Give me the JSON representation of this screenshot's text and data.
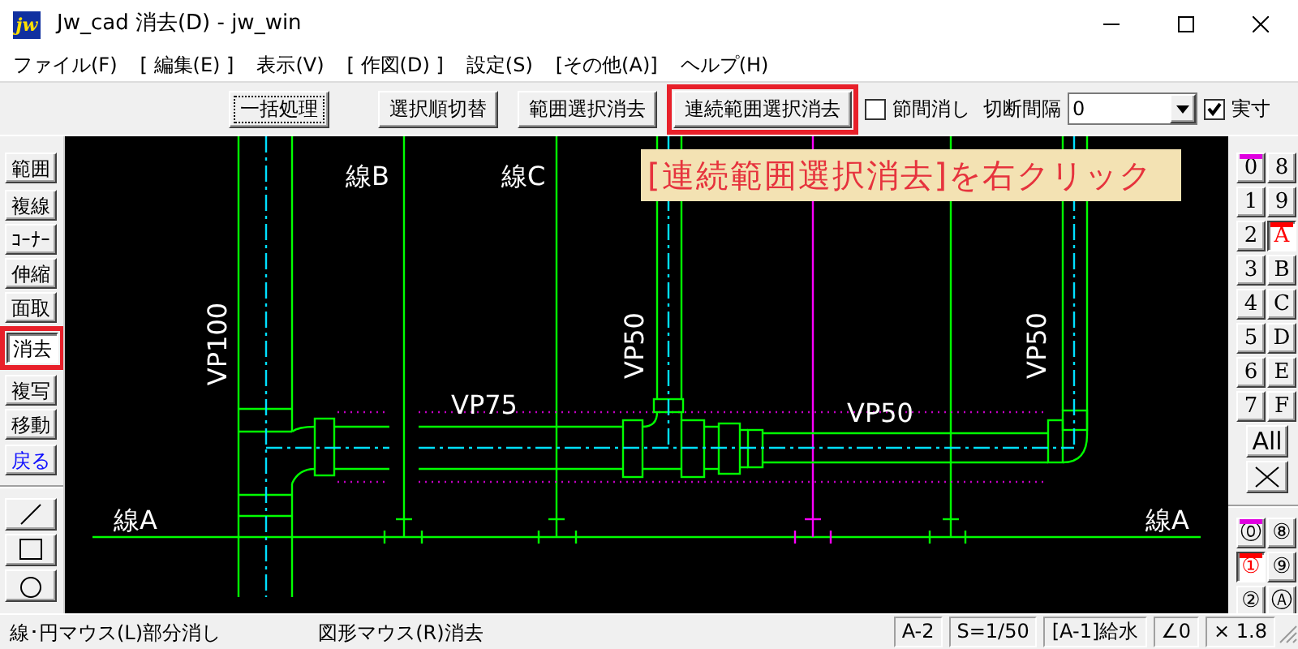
{
  "window": {
    "icon_text": "jw",
    "title": "Jw_cad 消去(D) - jw_win"
  },
  "menu": [
    "ファイル(F)",
    "[ 編集(E) ]",
    "表示(V)",
    "[ 作図(D) ]",
    "設定(S)",
    "[その他(A)]",
    "ヘルプ(H)"
  ],
  "toolbar": {
    "buttons": [
      {
        "label": "一括処理",
        "focused": true,
        "highlighted": false
      },
      {
        "label": "選択順切替",
        "focused": false,
        "highlighted": false
      },
      {
        "label": "範囲選択消去",
        "focused": false,
        "highlighted": false
      },
      {
        "label": "連続範囲選択消去",
        "focused": false,
        "highlighted": true
      }
    ],
    "options": [
      {
        "kind": "checkbox",
        "label": "節間消し",
        "checked": false
      },
      {
        "kind": "label",
        "label": "切断間隔"
      },
      {
        "kind": "combo",
        "value": "0"
      },
      {
        "kind": "checkbox",
        "label": "実寸",
        "checked": true
      }
    ]
  },
  "left_tools": [
    {
      "kind": "command",
      "label": "範囲",
      "selected": false,
      "highlighted": false
    },
    {
      "kind": "command",
      "label": "複線",
      "selected": false,
      "highlighted": false
    },
    {
      "kind": "command",
      "label": "ｺｰﾅｰ",
      "selected": false,
      "highlighted": false
    },
    {
      "kind": "command",
      "label": "伸縮",
      "selected": false,
      "highlighted": false
    },
    {
      "kind": "command",
      "label": "面取",
      "selected": false,
      "highlighted": false
    },
    {
      "kind": "command",
      "label": "消去",
      "selected": true,
      "highlighted": true
    },
    {
      "kind": "command",
      "label": "複写",
      "selected": false,
      "highlighted": false
    },
    {
      "kind": "command",
      "label": "移動",
      "selected": false,
      "highlighted": false
    },
    {
      "kind": "undo",
      "label": "戻る",
      "selected": false,
      "highlighted": false
    }
  ],
  "draw_tools": [
    {
      "kind": "line"
    },
    {
      "kind": "rectangle"
    },
    {
      "kind": "circle"
    }
  ],
  "canvas": {
    "labels": [
      {
        "kind": "horizontal",
        "text": "線B"
      },
      {
        "kind": "horizontal",
        "text": "線C"
      },
      {
        "kind": "vertical",
        "text": "VP100"
      },
      {
        "kind": "vertical",
        "text": "VP50"
      },
      {
        "kind": "horizontal",
        "text": "VP75"
      },
      {
        "kind": "horizontal",
        "text": "VP50"
      },
      {
        "kind": "vertical",
        "text": "VP50"
      },
      {
        "kind": "horizontal",
        "text": "線A"
      },
      {
        "kind": "horizontal",
        "text": "線A"
      }
    ],
    "callout": "[連続範囲選択消去]を右クリック"
  },
  "layers": {
    "items": [
      {
        "label": "0",
        "selected": false,
        "color": "#e000e0"
      },
      {
        "label": "8",
        "selected": false
      },
      {
        "label": "1",
        "selected": false
      },
      {
        "label": "9",
        "selected": false
      },
      {
        "label": "2",
        "selected": false
      },
      {
        "label": "A",
        "selected": true,
        "color": "#ff0000"
      },
      {
        "label": "3",
        "selected": false
      },
      {
        "label": "B",
        "selected": false
      },
      {
        "label": "4",
        "selected": false
      },
      {
        "label": "C",
        "selected": false
      },
      {
        "label": "5",
        "selected": false
      },
      {
        "label": "D",
        "selected": false
      },
      {
        "label": "6",
        "selected": false
      },
      {
        "label": "E",
        "selected": false
      },
      {
        "label": "7",
        "selected": false
      },
      {
        "label": "F",
        "selected": false
      }
    ],
    "all": "All"
  },
  "layer_groups": [
    {
      "label": "⓪",
      "selected": false,
      "color": "#e000e0"
    },
    {
      "label": "⑧",
      "selected": false
    },
    {
      "label": "①",
      "selected": true,
      "color": "#ff0000"
    },
    {
      "label": "⑨",
      "selected": false
    },
    {
      "label": "②",
      "selected": false
    },
    {
      "label": "Ⓐ",
      "selected": false
    }
  ],
  "status_bar": {
    "hints": [
      "線･円マウス(L)部分消し",
      "図形マウス(R)消去"
    ],
    "fields": [
      "A-2",
      "S=1/50",
      "[A-1]給水",
      "∠0",
      "× 1.8"
    ]
  }
}
